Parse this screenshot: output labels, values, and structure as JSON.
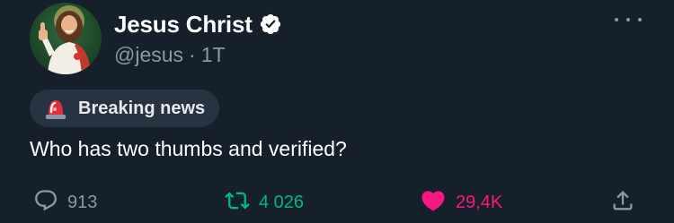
{
  "tweet": {
    "author": {
      "display_name": "Jesus Christ",
      "handle": "@jesus",
      "separator": "·",
      "timestamp": "1T",
      "verified": true
    },
    "badge": {
      "icon": "police-siren-icon",
      "label": "Breaking news"
    },
    "text": "Who has two thumbs and verified?",
    "actions": {
      "replies": "913",
      "retweets": "4 026",
      "likes": "29,4K"
    },
    "liked": true
  },
  "colors": {
    "background": "#15202b",
    "secondary_text": "#8b98a5",
    "verified_badge": "#ffffff",
    "retweet_green": "#00ba7c",
    "like_pink": "#f91880",
    "pill_background": "#273340"
  }
}
